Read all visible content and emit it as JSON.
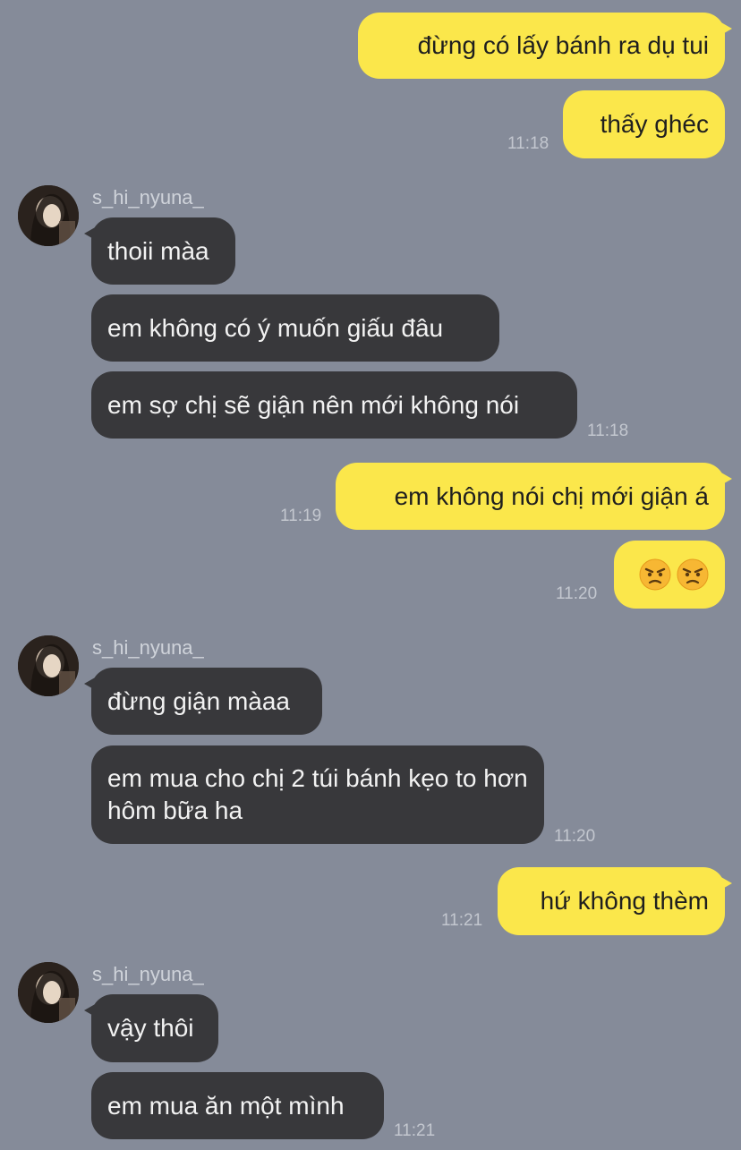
{
  "chat": {
    "messages": [
      {
        "text": "đừng có lấy bánh ra dụ tui"
      },
      {
        "text": "thấy ghéc",
        "time": "11:18"
      },
      {
        "text": "thoii màa"
      },
      {
        "text": "em không có ý muốn giấu đâu"
      },
      {
        "text": "em sợ chị sẽ giận nên mới không nói",
        "time": "11:18"
      },
      {
        "text": "em không nói chị mới giận á",
        "time": "11:19"
      },
      {
        "time": "11:20",
        "emoji": [
          "angry-face-icon",
          "angry-face-icon"
        ]
      },
      {
        "text": "đừng giận màaa"
      },
      {
        "text": "em mua cho chị 2 túi bánh kẹo to hơn hôm bữa ha",
        "time": "11:20"
      },
      {
        "text": "hứ không thèm",
        "time": "11:21"
      },
      {
        "text": "vậy thôi"
      },
      {
        "text": "em mua ăn một mình",
        "time": "11:21"
      }
    ],
    "sender_name": "s_hi_nyuna_"
  },
  "colors": {
    "background": "#858b99",
    "my_bubble": "#fbe74b",
    "their_bubble": "#38383b"
  }
}
